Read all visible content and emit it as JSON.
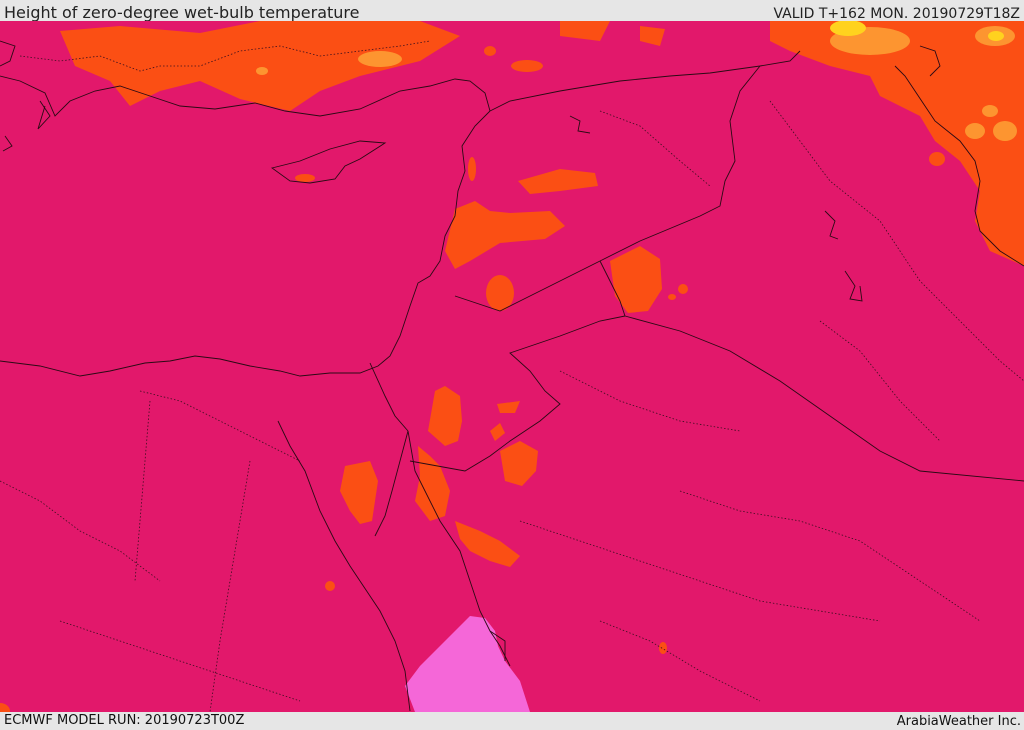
{
  "header": {
    "title": "Height of zero-degree wet-bulb temperature",
    "valid": "VALID T+162 MON. 20190729T18Z"
  },
  "footer": {
    "model_run": "ECMWF MODEL RUN: 20190723T00Z",
    "credit": "ArabiaWeather Inc."
  },
  "colors": {
    "base_fill": "#e2186b",
    "orange_fill": "#fb4f14",
    "light_orange_fill": "#fd9530",
    "yellow_fill": "#ffd21e",
    "pink_fill": "#f567d8",
    "border_line": "#2a0a14"
  }
}
